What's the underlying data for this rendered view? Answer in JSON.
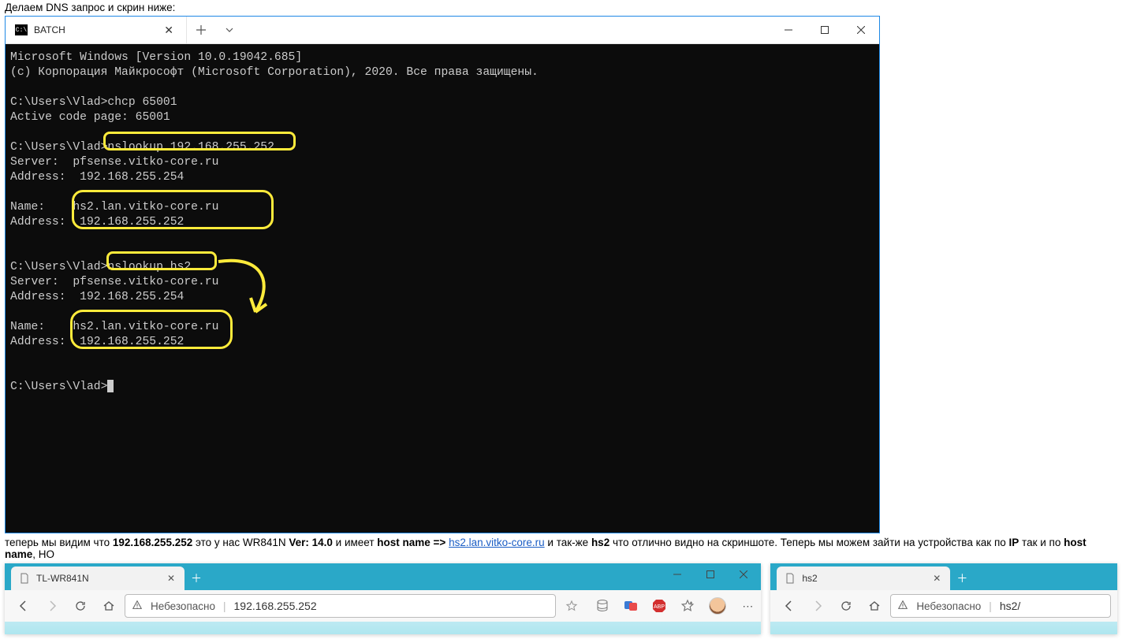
{
  "intro_text": "Делаем DNS запрос и скрин ниже:",
  "terminal": {
    "tab_title": "BATCH",
    "lines": {
      "l0": "Microsoft Windows [Version 10.0.19042.685]",
      "l1": "(c) Корпорация Майкрософт (Microsoft Corporation), 2020. Все права защищены.",
      "l2": "",
      "l3": "C:\\Users\\Vlad>chcp 65001",
      "l4": "Active code page: 65001",
      "l5": "",
      "l6": "C:\\Users\\Vlad>nslookup 192.168.255.252",
      "l7": "Server:  pfsense.vitko-core.ru",
      "l8": "Address:  192.168.255.254",
      "l9": "",
      "l10": "Name:    hs2.lan.vitko-core.ru",
      "l11": "Address:  192.168.255.252",
      "l12": "",
      "l13": "",
      "l14": "C:\\Users\\Vlad>nslookup hs2",
      "l15": "Server:  pfsense.vitko-core.ru",
      "l16": "Address:  192.168.255.254",
      "l17": "",
      "l18": "Name:    hs2.lan.vitko-core.ru",
      "l19": "Address:  192.168.255.252",
      "l20": "",
      "l21": "",
      "l22": "C:\\Users\\Vlad>"
    }
  },
  "outro": {
    "t1": "теперь мы видим что ",
    "b1": "192.168.255.252",
    "t2": " это у нас WR841N ",
    "b2": "Ver: 14.0",
    "t3": " и имеет ",
    "b3": "host name =>",
    "link": "hs2.lan.vitko-core.ru",
    "t4": " и так-же ",
    "b4": "hs2",
    "t5": " что отлично видно на скриншоте. Теперь мы можем зайти на устройства как по ",
    "b5": "IP",
    "t6": " так и по ",
    "b6": "host name",
    "t7": ", НО"
  },
  "browser_left": {
    "tab_title": "TL-WR841N",
    "insecure_label": "Небезопасно",
    "url": "192.168.255.252"
  },
  "browser_right": {
    "tab_title": "hs2",
    "insecure_label": "Небезопасно",
    "url": "hs2/"
  }
}
